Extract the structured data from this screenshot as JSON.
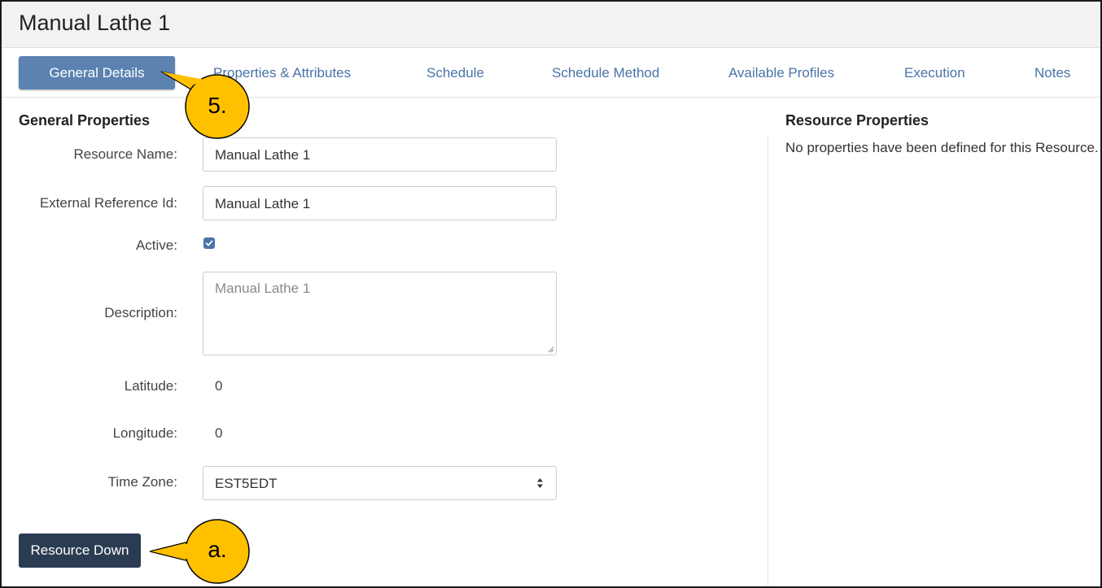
{
  "window": {
    "title": "Manual Lathe 1"
  },
  "tabs": [
    {
      "label": "General Details",
      "active": true
    },
    {
      "label": "Properties & Attributes",
      "active": false
    },
    {
      "label": "Schedule",
      "active": false
    },
    {
      "label": "Schedule Method",
      "active": false
    },
    {
      "label": "Available Profiles",
      "active": false
    },
    {
      "label": "Execution",
      "active": false
    },
    {
      "label": "Notes",
      "active": false
    }
  ],
  "general_properties": {
    "heading": "General Properties",
    "resource_name": {
      "label": "Resource Name:",
      "value": "Manual Lathe 1"
    },
    "external_reference_id": {
      "label": "External Reference Id:",
      "value": "Manual Lathe 1"
    },
    "active": {
      "label": "Active:",
      "checked": true
    },
    "description": {
      "label": "Description:",
      "placeholder": "Manual Lathe 1"
    },
    "latitude": {
      "label": "Latitude:",
      "value": "0"
    },
    "longitude": {
      "label": "Longitude:",
      "value": "0"
    },
    "time_zone": {
      "label": "Time Zone:",
      "selected": "EST5EDT"
    },
    "resource_down_button": "Resource Down"
  },
  "resource_properties": {
    "heading": "Resource Properties",
    "empty_message": "No properties have been defined for this Resource."
  },
  "callouts": [
    {
      "label": "5.",
      "target": "General Details tab"
    },
    {
      "label": "a.",
      "target": "Resource Down button"
    }
  ],
  "colors": {
    "active_tab": "#5b82b0",
    "tab_link": "#4a73a8",
    "button_dark": "#2b3c52",
    "callout_fill": "#ffc000"
  }
}
